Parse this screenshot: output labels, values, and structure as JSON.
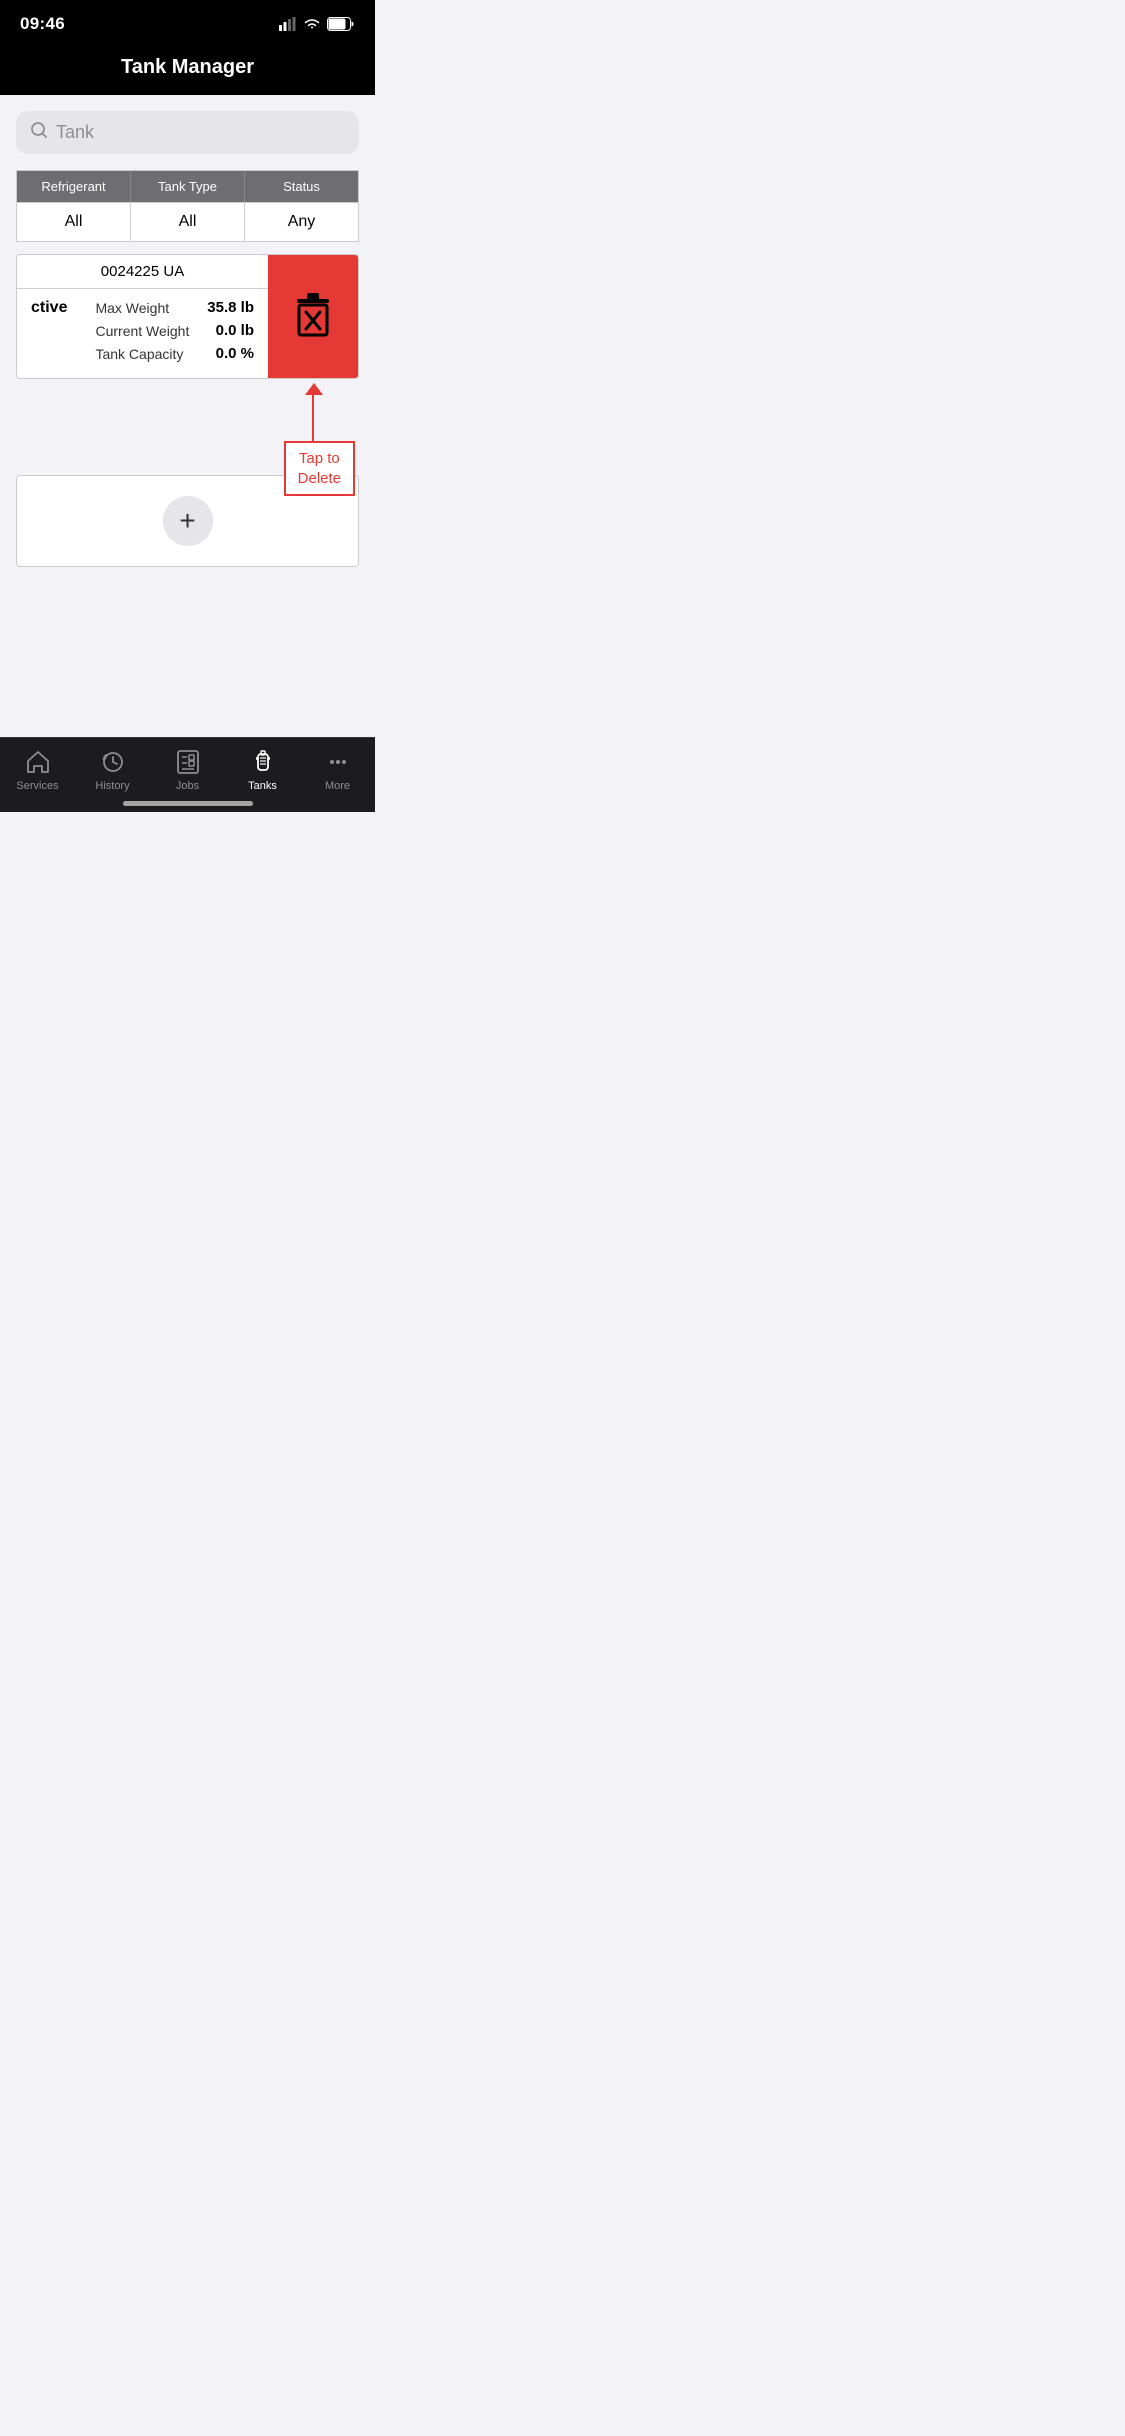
{
  "statusBar": {
    "time": "09:46"
  },
  "header": {
    "title": "Tank Manager"
  },
  "search": {
    "placeholder": "Tank"
  },
  "filters": {
    "headers": [
      "Refrigerant",
      "Tank Type",
      "Status"
    ],
    "values": [
      "All",
      "All",
      "Any"
    ]
  },
  "tankCard": {
    "id": "0024225 UA",
    "status": "ctive",
    "maxWeightLabel": "Max Weight",
    "maxWeightValue": "35.8 lb",
    "currentWeightLabel": "Current Weight",
    "currentWeightValue": "0.0 lb",
    "tankCapacityLabel": "Tank Capacity",
    "tankCapacityValue": "0.0 %"
  },
  "deleteTooltip": {
    "text": "Tap to\nDelete"
  },
  "addButton": {
    "label": "+"
  },
  "tabBar": {
    "items": [
      {
        "id": "services",
        "label": "Services",
        "active": false
      },
      {
        "id": "history",
        "label": "History",
        "active": false
      },
      {
        "id": "jobs",
        "label": "Jobs",
        "active": false
      },
      {
        "id": "tanks",
        "label": "Tanks",
        "active": true
      },
      {
        "id": "more",
        "label": "More",
        "active": false
      }
    ]
  }
}
